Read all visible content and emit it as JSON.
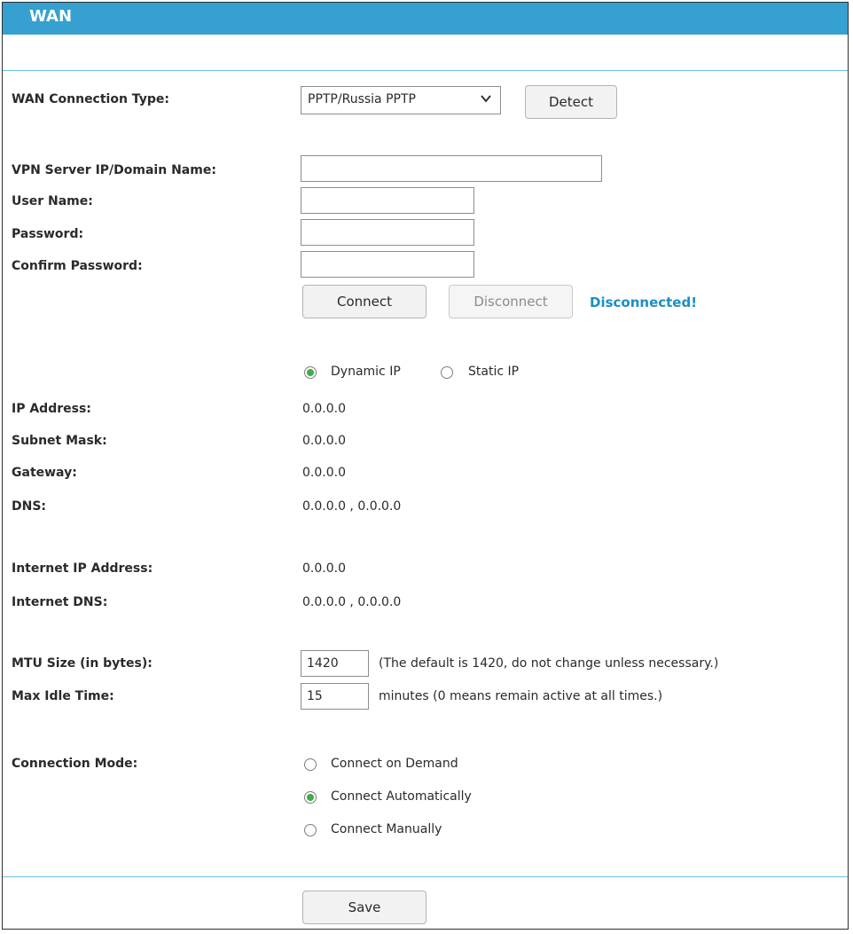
{
  "title": "WAN",
  "connection_type": {
    "label": "WAN Connection Type:",
    "selected": "PPTP/Russia PPTP",
    "detect_label": "Detect"
  },
  "vpn_server": {
    "label": "VPN Server IP/Domain Name:",
    "value": ""
  },
  "user_name": {
    "label": "User Name:",
    "value": ""
  },
  "password": {
    "label": "Password:",
    "value": ""
  },
  "confirm_password": {
    "label": "Confirm Password:",
    "value": ""
  },
  "connect_label": "Connect",
  "disconnect_label": "Disconnect",
  "status_text": "Disconnected!",
  "ip_mode": {
    "dynamic_label": "Dynamic IP",
    "static_label": "Static IP",
    "selected": "Dynamic IP"
  },
  "ip_address": {
    "label": "IP Address:",
    "value": "0.0.0.0"
  },
  "subnet_mask": {
    "label": "Subnet Mask:",
    "value": "0.0.0.0"
  },
  "gateway": {
    "label": "Gateway:",
    "value": "0.0.0.0"
  },
  "dns": {
    "label": "DNS:",
    "value": "0.0.0.0 , 0.0.0.0"
  },
  "internet_ip": {
    "label": "Internet IP Address:",
    "value": "0.0.0.0"
  },
  "internet_dns": {
    "label": "Internet DNS:",
    "value": "0.0.0.0 , 0.0.0.0"
  },
  "mtu": {
    "label": "MTU Size (in bytes):",
    "value": "1420",
    "note": "(The default is 1420, do not change unless necessary.)"
  },
  "max_idle": {
    "label": "Max Idle Time:",
    "value": "15",
    "note": "minutes (0 means remain active at all times.)"
  },
  "connection_mode": {
    "label": "Connection Mode:",
    "options": [
      "Connect on Demand",
      "Connect Automatically",
      "Connect Manually"
    ],
    "selected": "Connect Automatically"
  },
  "save_label": "Save",
  "colors": {
    "header": "#36a1d1",
    "status": "#1b8ec5",
    "radio_selected": "#3fae49"
  }
}
